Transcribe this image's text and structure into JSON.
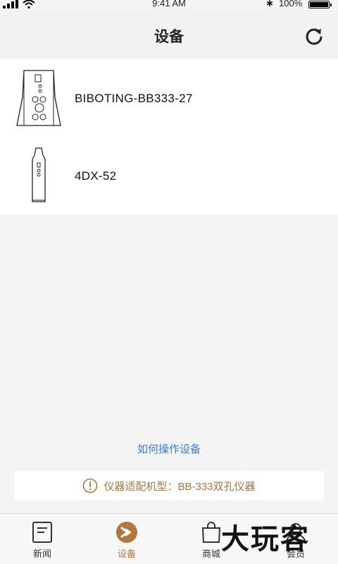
{
  "status_bar": {
    "time": "9:41 AM",
    "battery_text": "100%",
    "bluetooth_icon": "bluetooth-icon"
  },
  "header": {
    "title": "设备",
    "refresh_icon": "refresh-icon"
  },
  "devices": [
    {
      "name": "BIBOTING-BB333-27",
      "icon": "device-dual-hole-icon"
    },
    {
      "name": "4DX-52",
      "icon": "device-wand-icon"
    }
  ],
  "help_link": "如何操作设备",
  "notice": {
    "text": "仪器适配机型：BB-333双孔仪器",
    "icon": "info-circle-icon",
    "color": "#a8743f"
  },
  "tabs": [
    {
      "label": "新闻",
      "icon": "news-icon",
      "active": false
    },
    {
      "label": "设备",
      "icon": "device-tab-icon",
      "active": true
    },
    {
      "label": "商城",
      "icon": "shopping-bag-icon",
      "active": false
    },
    {
      "label": "会员",
      "icon": "member-icon",
      "active": false
    }
  ],
  "watermark": "大玩客",
  "colors": {
    "accent": "#b0773f",
    "link": "#3b7bd4"
  }
}
